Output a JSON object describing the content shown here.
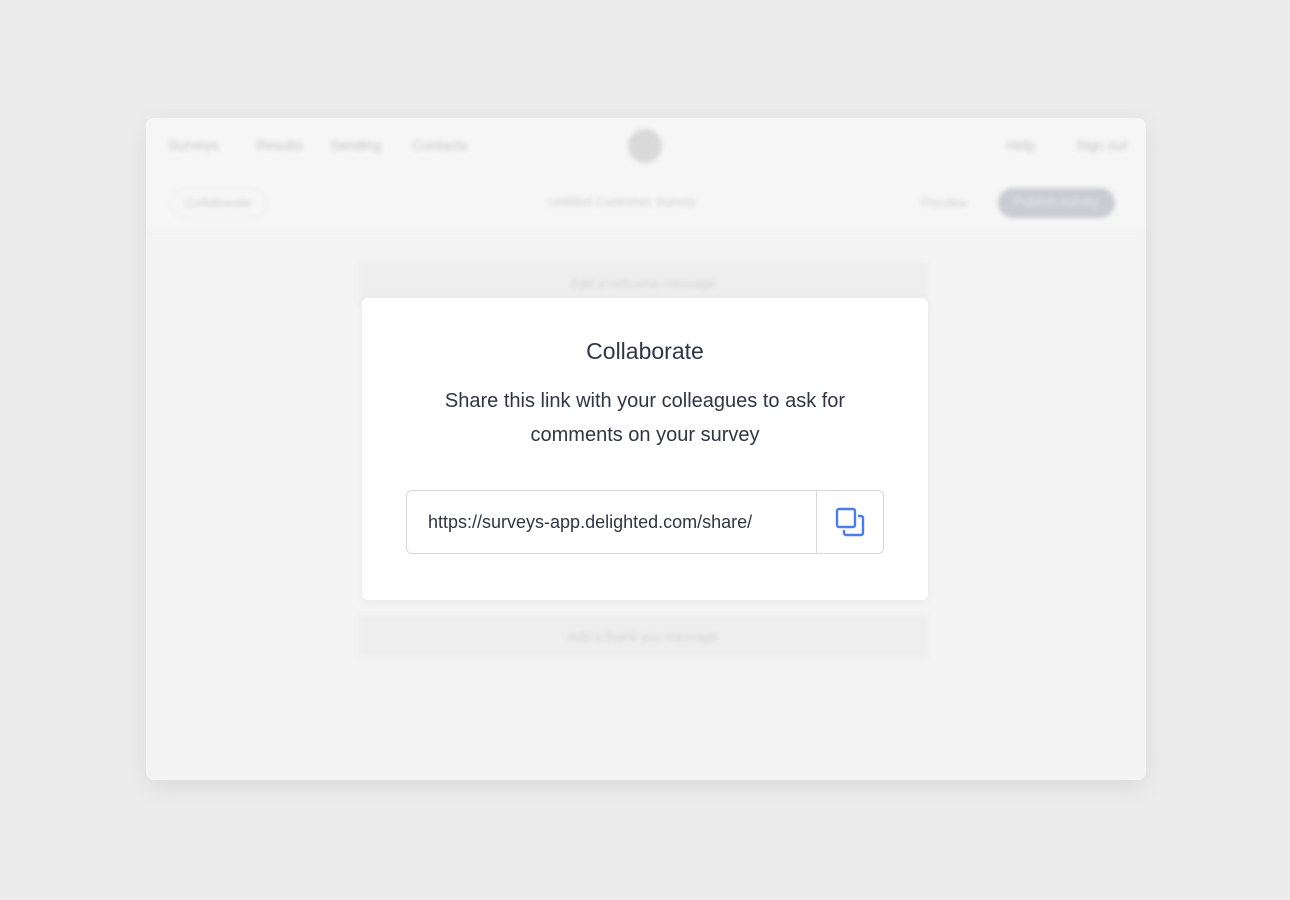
{
  "background_app": {
    "nav_left": [
      "Surveys",
      "Results",
      "Sending",
      "Contacts"
    ],
    "nav_right": [
      "Help",
      "Sign out"
    ],
    "toolbar": {
      "collaborate_label": "Collaborate",
      "survey_title": "Untitled Customer Survey",
      "preview_label": "Preview",
      "primary_label": "Publish survey"
    },
    "cards": [
      "Add a welcome message",
      "Add a thank you message"
    ]
  },
  "modal": {
    "title": "Collaborate",
    "description": "Share this link with your colleagues to ask for comments on your survey",
    "share_link": "https://surveys-app.delighted.com/share/",
    "copy_icon": "copy-icon"
  },
  "colors": {
    "accent": "#4a7ee8",
    "text": "#2f3542",
    "border": "#d6d8dc"
  }
}
